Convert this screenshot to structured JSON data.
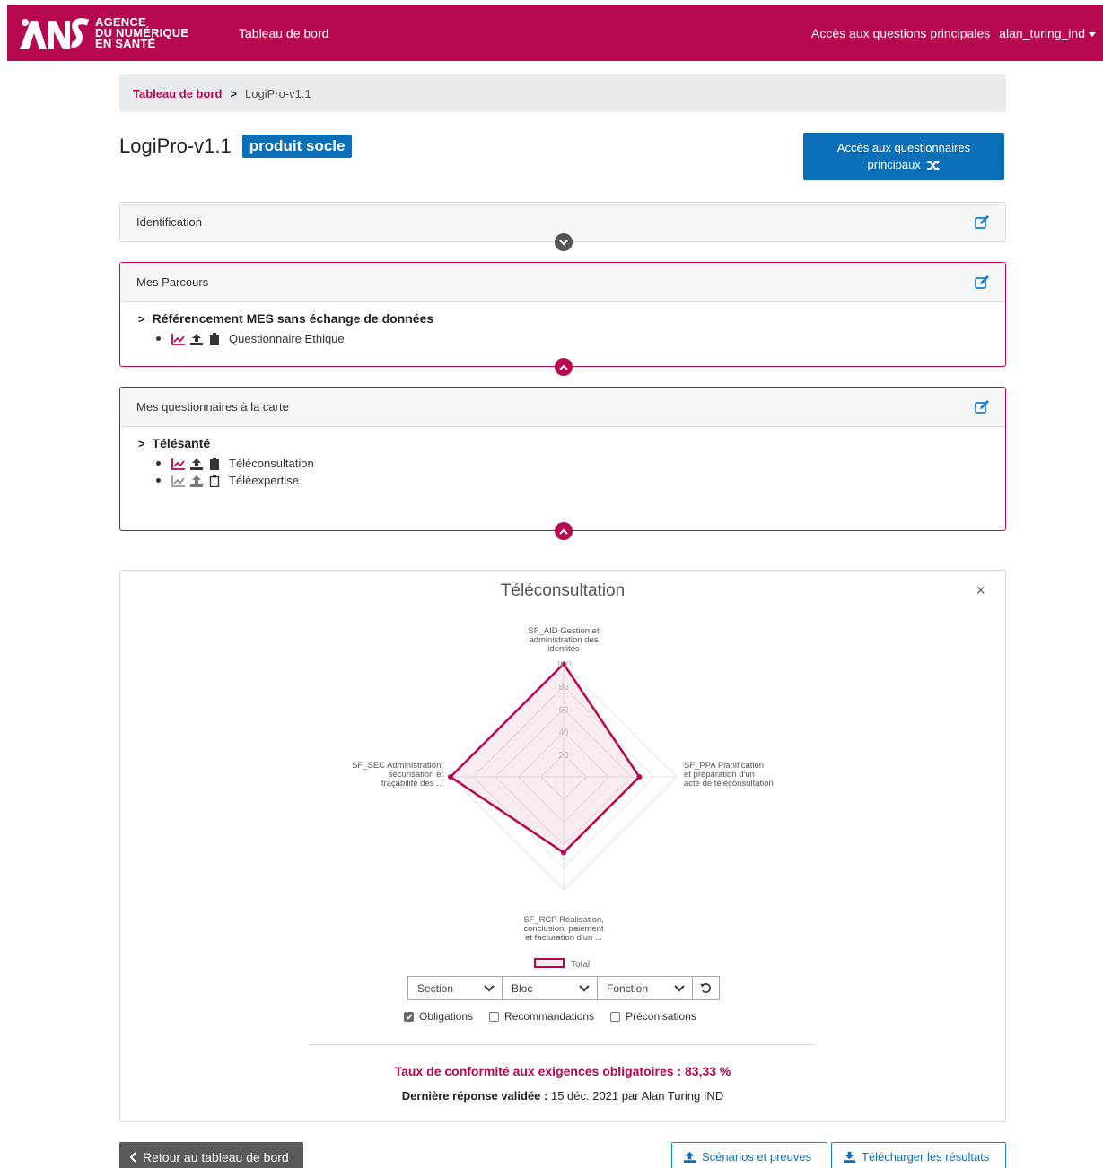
{
  "header": {
    "logo_lines": [
      "AGENCE",
      "DU NUMÉRIQUE",
      "EN SANTÉ"
    ],
    "nav_dashboard": "Tableau de bord",
    "nav_main_questions": "Accès aux questions principales",
    "user_name": "alan_turing_ind"
  },
  "breadcrumb": {
    "link": "Tableau de bord",
    "separator": ">",
    "current": "LogiPro-v1.1"
  },
  "page": {
    "title": "LogiPro-v1.1",
    "badge": "produit socle",
    "quest_button_line1": "Accès aux questionnaires",
    "quest_button_line2": "principaux"
  },
  "identification": {
    "header": "Identification"
  },
  "parcours": {
    "header": "Mes Parcours",
    "group": "Référencement MES sans échange de données",
    "items": [
      {
        "label": "Questionnaire Ethique",
        "active": true
      }
    ]
  },
  "carte": {
    "header": "Mes questionnaires à la carte",
    "group": "Télésanté",
    "items": [
      {
        "label": "Téléconsultation",
        "active": true
      },
      {
        "label": "Téléexpertise",
        "active": false
      }
    ]
  },
  "chart_panel": {
    "close": "×",
    "section_select": "Section",
    "bloc_select": "Bloc",
    "fonction_select": "Fonction",
    "check_obligations": "Obligations",
    "check_recommandations": "Recommandations",
    "check_preconisations": "Préconisations",
    "rate_text": "Taux de conformité aux exigences obligatoires : 83,33 %",
    "last_label": "Dernière réponse validée :",
    "last_value": " 15 déc. 2021 par Alan Turing IND"
  },
  "chart_data": {
    "type": "radar",
    "title": "Téléconsultation",
    "axes": [
      [
        "SF_AID Gestion et",
        "administration des",
        "identités"
      ],
      [
        "SF_PPA Planification",
        "et préparation d'un",
        "acte de téléconsultation"
      ],
      [
        "SF_RCP Réalisation,",
        "conclusion, paiement",
        "et facturation d'un ..."
      ],
      [
        "SF_SEC Administration,",
        "sécurisation et",
        "traçabilité des ..."
      ]
    ],
    "ticks": [
      "20",
      "40",
      "60",
      "80",
      "100"
    ],
    "range": [
      0,
      100
    ],
    "series": [
      {
        "name": "Total",
        "values": [
          100,
          67,
          67,
          100
        ]
      }
    ],
    "colors": {
      "line": "#b5084f",
      "fill": "rgba(181,8,79,0.08)"
    }
  },
  "footer": {
    "back_button": "Retour au tableau de bord",
    "scenarios_button": "Scénarios et preuves",
    "download_button": "Télécharger les résultats"
  }
}
